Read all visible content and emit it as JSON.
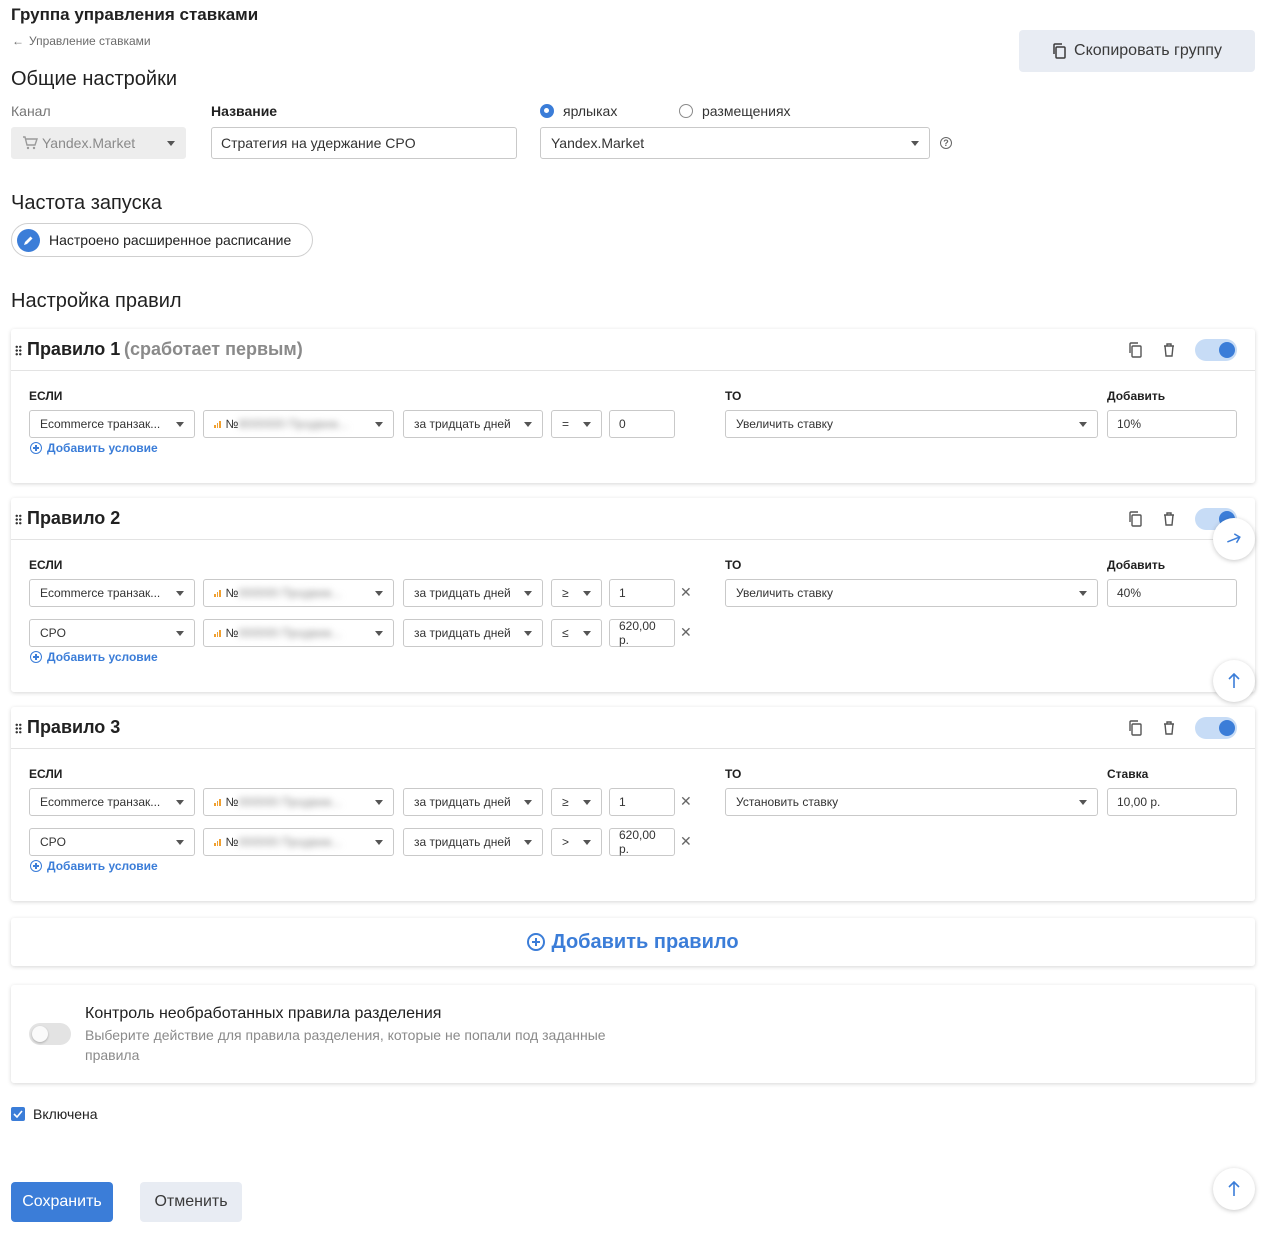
{
  "header": {
    "title": "Группа управления ставками",
    "breadcrumb": "Управление ставками",
    "copy_group_label": "Скопировать группу"
  },
  "general": {
    "title": "Общие настройки",
    "channel_label": "Канал",
    "channel_value": "Yandex.Market",
    "name_label": "Название",
    "name_value": "Стратегия на удержание CPO",
    "radio_labels": [
      "ярлыках",
      "размещениях"
    ],
    "radio_selected": 0,
    "target_value": "Yandex.Market"
  },
  "frequency": {
    "title": "Частота запуска",
    "schedule_label": "Настроено расширенное расписание"
  },
  "rules_section": {
    "title": "Настройка правил",
    "if_label": "ЕСЛИ",
    "then_label": "ТО",
    "add_condition_label": "Добавить условие"
  },
  "rules": [
    {
      "title": "Правило 1",
      "subtitle": "(сработает первым)",
      "enabled": true,
      "conditions": [
        {
          "metric": "Ecommerce транзак...",
          "object": "№",
          "object_hidden": "8000000 Продвиж...",
          "period": "за тридцать дней",
          "op": "=",
          "value": "0",
          "removable": false
        }
      ],
      "action": "Увеличить ставку",
      "value_label": "Добавить",
      "value": "10%"
    },
    {
      "title": "Правило 2",
      "subtitle": "",
      "enabled": true,
      "conditions": [
        {
          "metric": "Ecommerce транзак...",
          "object": "№",
          "object_hidden": "000000 Продвиж...",
          "period": "за тридцать дней",
          "op": "≥",
          "value": "1",
          "removable": true
        },
        {
          "metric": "CPO",
          "object": "№",
          "object_hidden": "000000 Продвиж...",
          "period": "за тридцать дней",
          "op": "≤",
          "value": "620,00 р.",
          "removable": true
        }
      ],
      "action": "Увеличить ставку",
      "value_label": "Добавить",
      "value": "40%"
    },
    {
      "title": "Правило 3",
      "subtitle": "",
      "enabled": true,
      "conditions": [
        {
          "metric": "Ecommerce транзак...",
          "object": "№",
          "object_hidden": "000000 Продвиж...",
          "period": "за тридцать дней",
          "op": "≥",
          "value": "1",
          "removable": true
        },
        {
          "metric": "CPO",
          "object": "№",
          "object_hidden": "000000 Продвиж...",
          "period": "за тридцать дней",
          "op": ">",
          "value": "620,00 р.",
          "removable": true
        }
      ],
      "action": "Установить ставку",
      "value_label": "Ставка",
      "value": "10,00 р."
    }
  ],
  "add_rule_label": "Добавить правило",
  "control": {
    "title": "Контроль необработанных правила разделения",
    "description": "Выберите действие для правила разделения, которые не попали под заданные правила",
    "enabled": false
  },
  "enabled_checkbox": {
    "label": "Включена",
    "checked": true
  },
  "footer": {
    "save_label": "Сохранить",
    "cancel_label": "Отменить"
  },
  "colors": {
    "accent": "#3b7dd8",
    "accent_light": "#c7dcf6",
    "button_secondary": "#e8ecf3",
    "metric_icon": "#f0a030"
  }
}
